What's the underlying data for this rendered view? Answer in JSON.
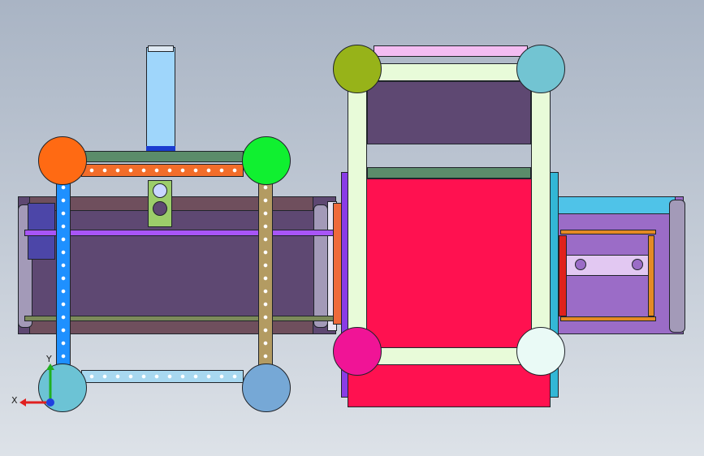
{
  "viewport": {
    "background_top": "#a9b4c4",
    "background_bottom": "#dde2e8"
  },
  "triad": {
    "x_label": "X",
    "y_label": "Y",
    "x_color": "#e02020",
    "y_color": "#20b020",
    "z_color": "#2040e0"
  },
  "colors": {
    "frame_dark": "#5e4872",
    "belt_red": "#ff1150",
    "frame_light": "#e8fbd9",
    "blue_rail": "#1e90ff",
    "tan_rail": "#b39b62",
    "orange_bar": "#f26d2a",
    "purple_bar": "#a855f7",
    "lavender": "#9b6cc7",
    "cyan": "#4fc3e8",
    "sky": "#8ad0f5"
  },
  "markers": [
    {
      "name": "orange-circle",
      "color": "#ff6a13"
    },
    {
      "name": "green-circle",
      "color": "#10f030"
    },
    {
      "name": "cyan-circle",
      "color": "#6cc3d5"
    },
    {
      "name": "steelblue-circle",
      "color": "#76a8d6"
    },
    {
      "name": "olive-circle",
      "color": "#97b319"
    },
    {
      "name": "teal-circle",
      "color": "#72c4d2"
    },
    {
      "name": "magenta-circle",
      "color": "#f01496"
    },
    {
      "name": "white-circle",
      "color": "#eafaf6"
    }
  ]
}
